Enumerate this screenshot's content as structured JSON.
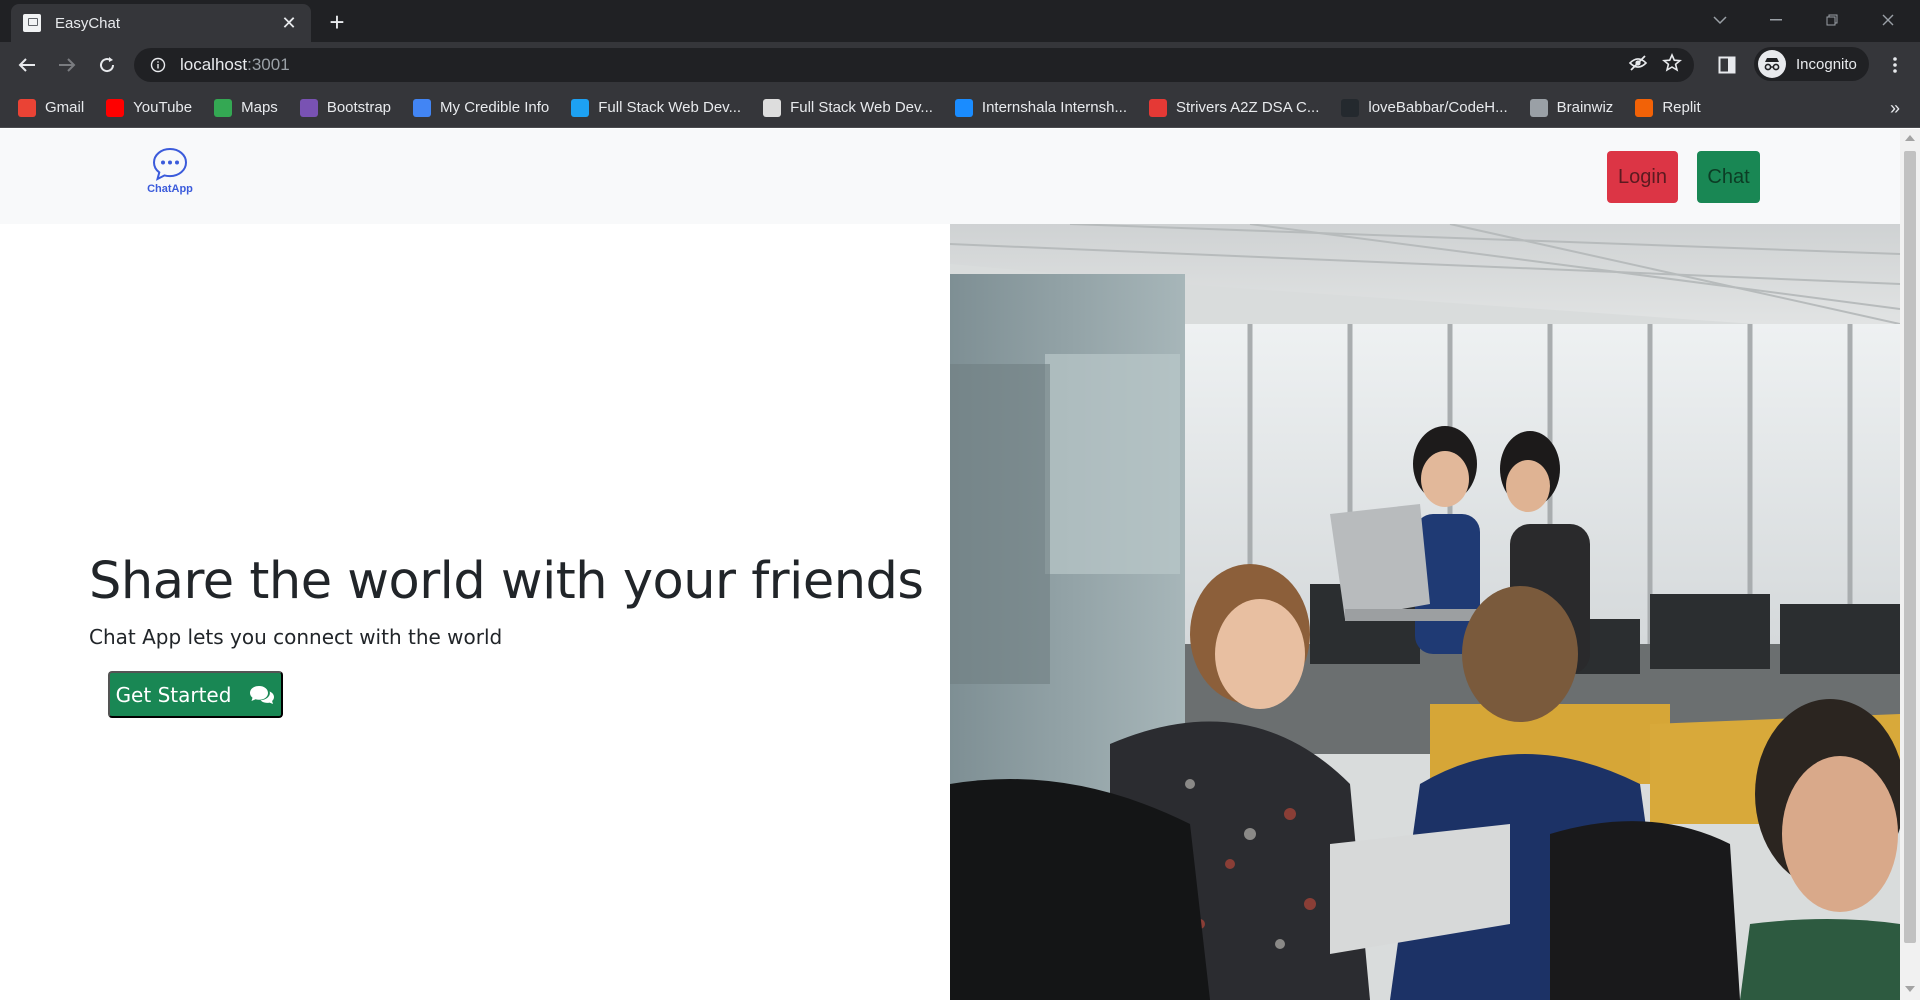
{
  "browser": {
    "tab_title": "EasyChat",
    "tab_close": "✕",
    "new_tab": "+",
    "url_host": "localhost",
    "url_port": ":3001",
    "profile_label": "Incognito",
    "bookmarks": [
      {
        "label": "Gmail",
        "icon": "gmail-icon",
        "color": "#ea4335"
      },
      {
        "label": "YouTube",
        "icon": "youtube-icon",
        "color": "#ff0000"
      },
      {
        "label": "Maps",
        "icon": "maps-icon",
        "color": "#34a853"
      },
      {
        "label": "Bootstrap",
        "icon": "bootstrap-icon",
        "color": "#7952b3"
      },
      {
        "label": "My Credible Info",
        "icon": "credible-icon",
        "color": "#4285f4"
      },
      {
        "label": "Full Stack Web Dev...",
        "icon": "webdev-icon",
        "color": "#1da1f2"
      },
      {
        "label": "Full Stack Web Dev...",
        "icon": "webdev2-icon",
        "color": "#dddddd"
      },
      {
        "label": "Internshala Internsh...",
        "icon": "internshala-icon",
        "color": "#1a8cff"
      },
      {
        "label": "Strivers A2Z DSA C...",
        "icon": "tuf-icon",
        "color": "#e53935"
      },
      {
        "label": "loveBabbar/CodeH...",
        "icon": "github-icon",
        "color": "#24292e"
      },
      {
        "label": "Brainwiz",
        "icon": "globe-icon",
        "color": "#9aa0a6"
      },
      {
        "label": "Replit",
        "icon": "replit-icon",
        "color": "#f26207"
      }
    ],
    "bookmarks_more": "»"
  },
  "page": {
    "brand_label": "ChatApp",
    "login_label": "Login",
    "chat_label": "Chat",
    "hero_title": "Share the world with your friends",
    "hero_subtitle": "Chat App lets you connect with the world",
    "cta_label": "Get Started"
  },
  "colors": {
    "login": "#dc3545",
    "chat": "#198754",
    "brand": "#3b5bdb"
  }
}
